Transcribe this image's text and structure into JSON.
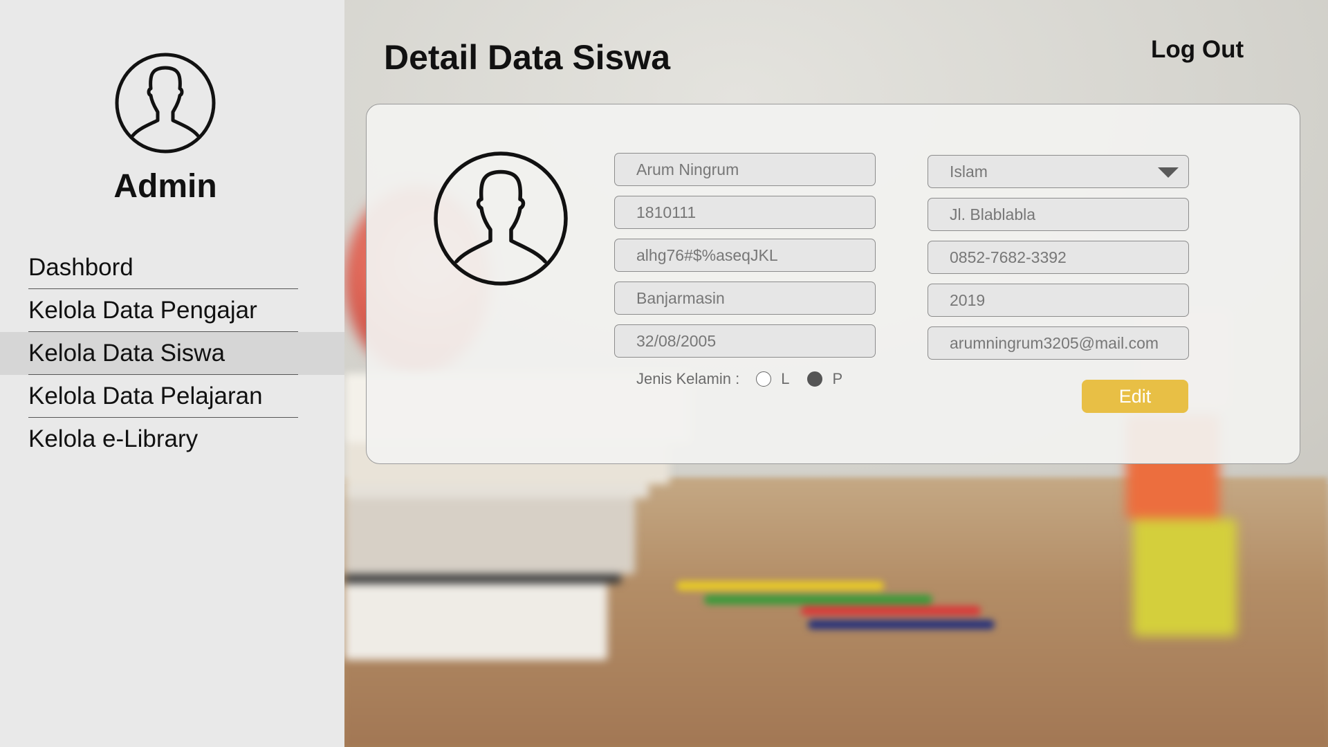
{
  "sidebar": {
    "admin_label": "Admin",
    "nav": [
      {
        "label": "Dashbord",
        "active": false
      },
      {
        "label": "Kelola Data Pengajar",
        "active": false
      },
      {
        "label": "Kelola Data Siswa",
        "active": true
      },
      {
        "label": "Kelola Data Pelajaran",
        "active": false
      },
      {
        "label": "Kelola e-Library",
        "active": false
      }
    ]
  },
  "header": {
    "title": "Detail Data Siswa",
    "logout_label": "Log Out"
  },
  "form": {
    "left": {
      "name": "Arum Ningrum",
      "nis": "1810111",
      "password": "alhg76#$%aseqJKL",
      "birthplace": "Banjarmasin",
      "birthdate": "32/08/2005"
    },
    "right": {
      "religion": "Islam",
      "address": "Jl. Blablabla",
      "phone": "0852-7682-3392",
      "year": "2019",
      "email": "arumningrum3205@mail.com"
    },
    "gender": {
      "label": "Jenis Kelamin :",
      "option_l": "L",
      "option_p": "P",
      "selected": "P"
    },
    "edit_label": "Edit"
  },
  "colors": {
    "sidebar_bg": "#e9e9e9",
    "active_nav_bg": "#d6d6d6",
    "edit_button": "#e8bf45",
    "field_bg": "#e6e6e6"
  },
  "icons": {
    "admin_avatar": "user-outline-icon",
    "student_avatar": "user-outline-icon",
    "religion_dropdown": "caret-down-icon"
  }
}
